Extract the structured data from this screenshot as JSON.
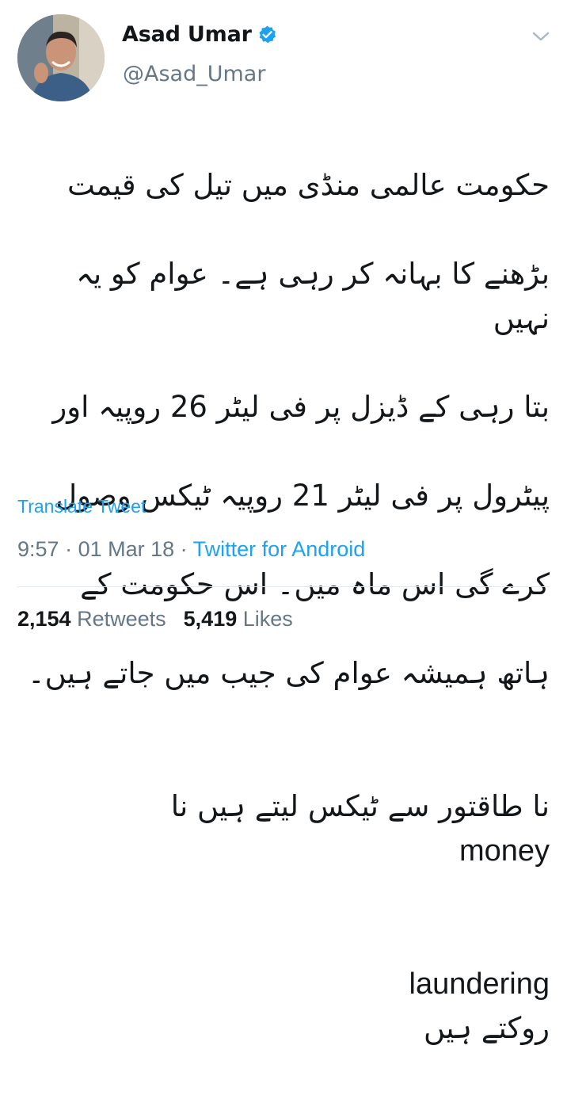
{
  "author": {
    "name": "Asad Umar",
    "handle": "@Asad_Umar",
    "verified": true
  },
  "tweet": {
    "lines": [
      "حکومت عالمی منڈی میں تیل کی قیمت",
      "بڑھنے کا بہانہ کر رہی ہے۔ عوام کو یہ نہیں",
      "بتا رہی کے ڈیزل پر فی لیٹر 26 روپیہ اور",
      "پیٹرول پر فی لیٹر 21 روپیہ ٹیکس وصول",
      "کرے گی اس ماہ میں۔ اس حکومت کے",
      "ہاتھ ہمیشہ عوام کی جیب میں جاتے ہیں۔",
      "نا طاقتور سے ٹیکس لیتے ہیں نا",
      "money",
      "laundering",
      "روکتے ہیں"
    ],
    "translate_label": "Translate Tweet",
    "time": "9:57",
    "date": "01 Mar 18",
    "separator": " · ",
    "source": "Twitter for Android"
  },
  "stats": {
    "retweets_count": "2,154",
    "retweets_label": "Retweets",
    "likes_count": "5,419",
    "likes_label": "Likes"
  },
  "icons": {
    "verified": "verified-badge-icon",
    "menu": "chevron-down-icon"
  },
  "colors": {
    "accent": "#1da1f2",
    "muted": "#657786",
    "text": "#14171a"
  }
}
